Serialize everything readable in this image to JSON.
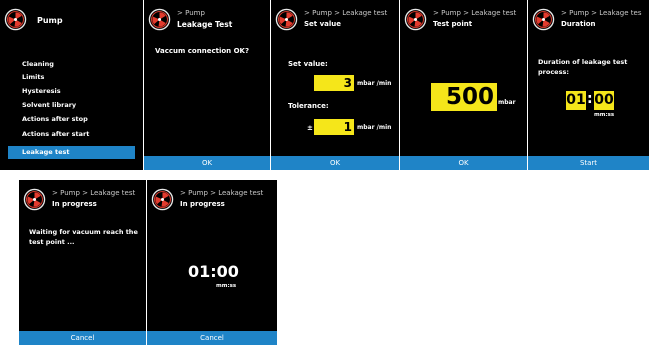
{
  "colors": {
    "accent": "#1f84c7",
    "value_highlight": "#f5e61a",
    "screen_bg": "#000000"
  },
  "icons": {
    "logo": "pump-logo-icon"
  },
  "screens": {
    "menu": {
      "title": "Pump",
      "items": [
        "Cleaning",
        "Limits",
        "Hysteresis",
        "Solvent library",
        "Actions after stop",
        "Actions after start",
        "Leakage test"
      ],
      "selected": "Leakage test"
    },
    "connection": {
      "breadcrumb": "> Pump",
      "title": "Leakage Test",
      "message": "Vaccum connection OK?",
      "button": "OK"
    },
    "set_value": {
      "breadcrumb": "> Pump > Leakage test",
      "title": "Set value",
      "setvalue_label": "Set value:",
      "setvalue_value": "3",
      "setvalue_unit": "mbar  /min",
      "tolerance_label": "Tolerance:",
      "tolerance_sign": "±",
      "tolerance_value": "1",
      "tolerance_unit": "mbar  /min",
      "button": "OK"
    },
    "test_point": {
      "breadcrumb": "> Pump > Leakage test",
      "title": "Test point",
      "value": "500",
      "unit": "mbar",
      "button": "OK"
    },
    "duration": {
      "breadcrumb": "> Pump > Leakage tes",
      "title": "Duration",
      "message": "Duration of leakage test process:",
      "minutes": "01",
      "colon": ":",
      "seconds": "00",
      "format": "mm:ss",
      "button": "Start"
    },
    "in_progress_waiting": {
      "breadcrumb": "> Pump > Leakage test",
      "title": "In progress",
      "message": "Waiting for vacuum reach the test point ...",
      "button": "Cancel"
    },
    "in_progress_timer": {
      "breadcrumb": "> Pump > Leakage test",
      "title": "In progress",
      "time": "01:00",
      "format": "mm:ss",
      "button": "Cancel"
    }
  }
}
